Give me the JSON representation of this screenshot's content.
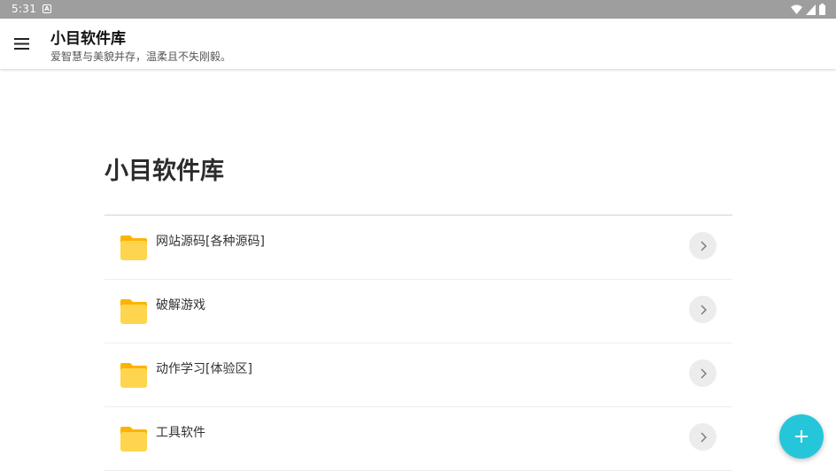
{
  "status_bar": {
    "time": "5:31",
    "notification_icon": "A",
    "icons": [
      "wifi-icon",
      "signal-icon",
      "battery-icon"
    ]
  },
  "toolbar": {
    "title": "小目软件库",
    "subtitle": "爱智慧与美貌并存，温柔且不失刚毅。",
    "menu_icon": "menu-icon"
  },
  "main": {
    "title": "小目软件库",
    "items": [
      {
        "label": "网站源码[各种源码]",
        "icon": "folder-icon"
      },
      {
        "label": "破解游戏",
        "icon": "folder-icon"
      },
      {
        "label": "动作学习[体验区]",
        "icon": "folder-icon"
      },
      {
        "label": "工具软件",
        "icon": "folder-icon"
      }
    ]
  },
  "fab": {
    "icon": "plus-icon"
  },
  "colors": {
    "status_bar": "#9e9e9e",
    "folder": "#ffd54f",
    "folder_tab": "#ffb300",
    "fab": "#26c6da"
  }
}
